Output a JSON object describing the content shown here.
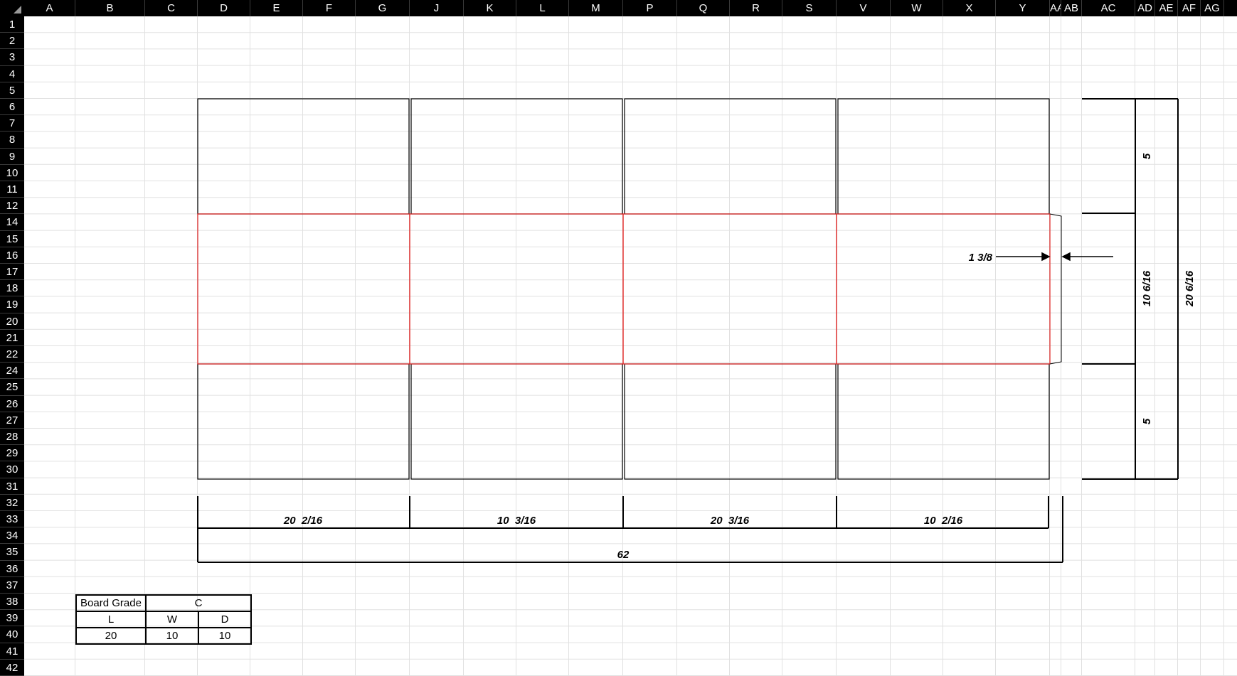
{
  "columns": [
    "A",
    "B",
    "C",
    "D",
    "E",
    "F",
    "G",
    "J",
    "K",
    "L",
    "M",
    "P",
    "Q",
    "R",
    "S",
    "V",
    "W",
    "X",
    "Y",
    "AA",
    "AB",
    "AC",
    "AD",
    "AE",
    "AF",
    "AG"
  ],
  "rows": [
    "1",
    "2",
    "3",
    "4",
    "5",
    "6",
    "7",
    "8",
    "9",
    "10",
    "11",
    "12",
    "14",
    "15",
    "16",
    "17",
    "18",
    "19",
    "20",
    "21",
    "22",
    "24",
    "25",
    "26",
    "27",
    "28",
    "29",
    "30",
    "31",
    "32",
    "33",
    "34",
    "35",
    "36",
    "37",
    "38",
    "39",
    "40",
    "41",
    "42"
  ],
  "dimensions": {
    "panel_1": "20  2/16",
    "panel_2": "10  3/16",
    "panel_3": "20  3/16",
    "panel_4": "10  2/16",
    "total_length": "62",
    "glue_flap": "1 3/8",
    "top_flap": "5",
    "body_height": "10 6/16",
    "bottom_flap": "5",
    "total_height": "20 6/16"
  },
  "board_table": {
    "grade_label": "Board Grade",
    "grade_value": "C",
    "headers": [
      "L",
      "W",
      "D"
    ],
    "values": [
      "20",
      "10",
      "10"
    ]
  },
  "colors": {
    "header_bg": "#000000",
    "gridline": "#e1e1e1",
    "crease": "#e0201f",
    "cut": "#000000"
  }
}
